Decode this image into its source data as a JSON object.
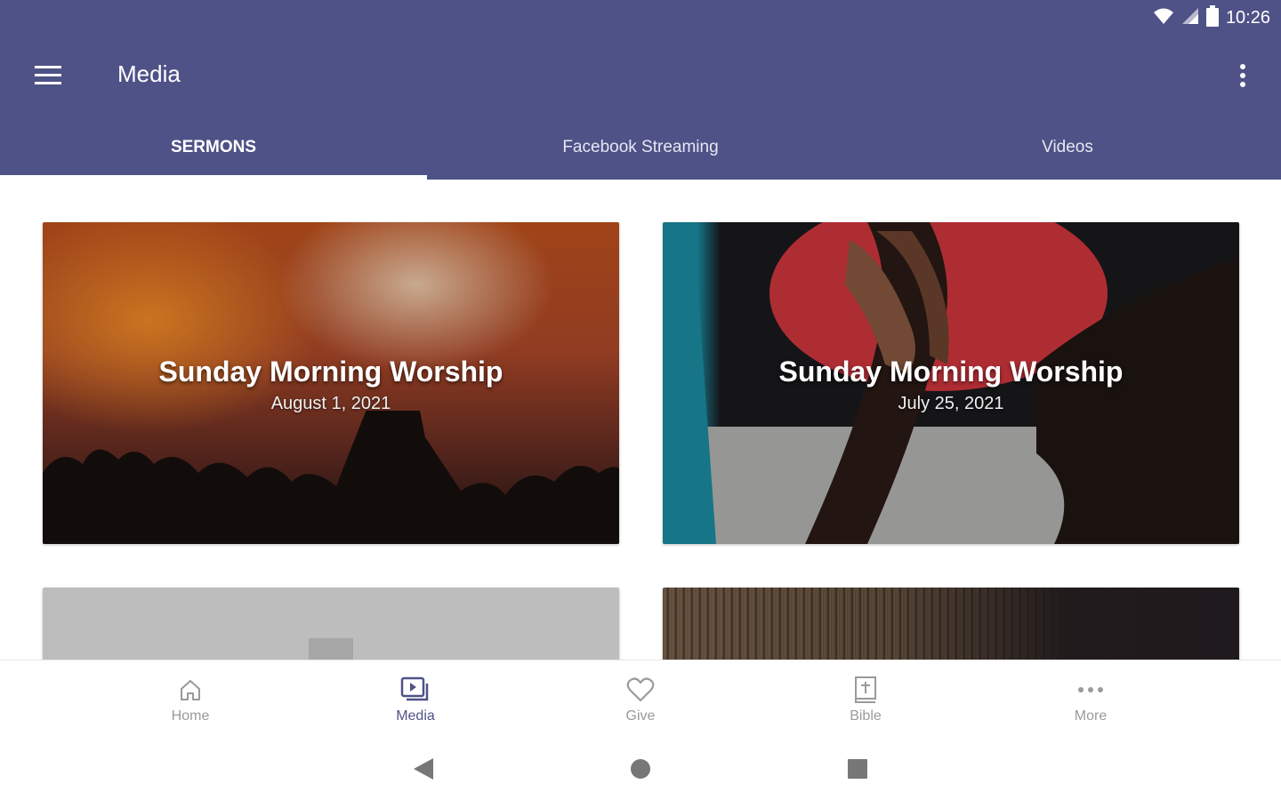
{
  "status_bar": {
    "time": "10:26",
    "icons": [
      "wifi-icon",
      "signal-icon",
      "battery-icon"
    ]
  },
  "app_bar": {
    "title": "Media",
    "menu_icon": "hamburger-menu-icon",
    "overflow_icon": "more-vert-icon"
  },
  "tabs": [
    {
      "label": "SERMONS",
      "active": true
    },
    {
      "label": "Facebook Streaming",
      "active": false
    },
    {
      "label": "Videos",
      "active": false
    }
  ],
  "cards": [
    {
      "title": "Sunday Morning Worship",
      "date": "August 1, 2021"
    },
    {
      "title": "Sunday Morning Worship",
      "date": "July 25, 2021"
    }
  ],
  "bottom_nav": [
    {
      "label": "Home",
      "icon": "home-icon",
      "active": false
    },
    {
      "label": "Media",
      "icon": "media-icon",
      "active": true
    },
    {
      "label": "Give",
      "icon": "heart-icon",
      "active": false
    },
    {
      "label": "Bible",
      "icon": "bible-icon",
      "active": false
    },
    {
      "label": "More",
      "icon": "more-horiz-icon",
      "active": false
    }
  ],
  "system_nav": [
    "back-icon",
    "home-circle-icon",
    "recents-icon"
  ],
  "colors": {
    "primary": "#4f5287",
    "tab_indicator": "#ffffff",
    "inactive_label": "#9a9a9a"
  }
}
